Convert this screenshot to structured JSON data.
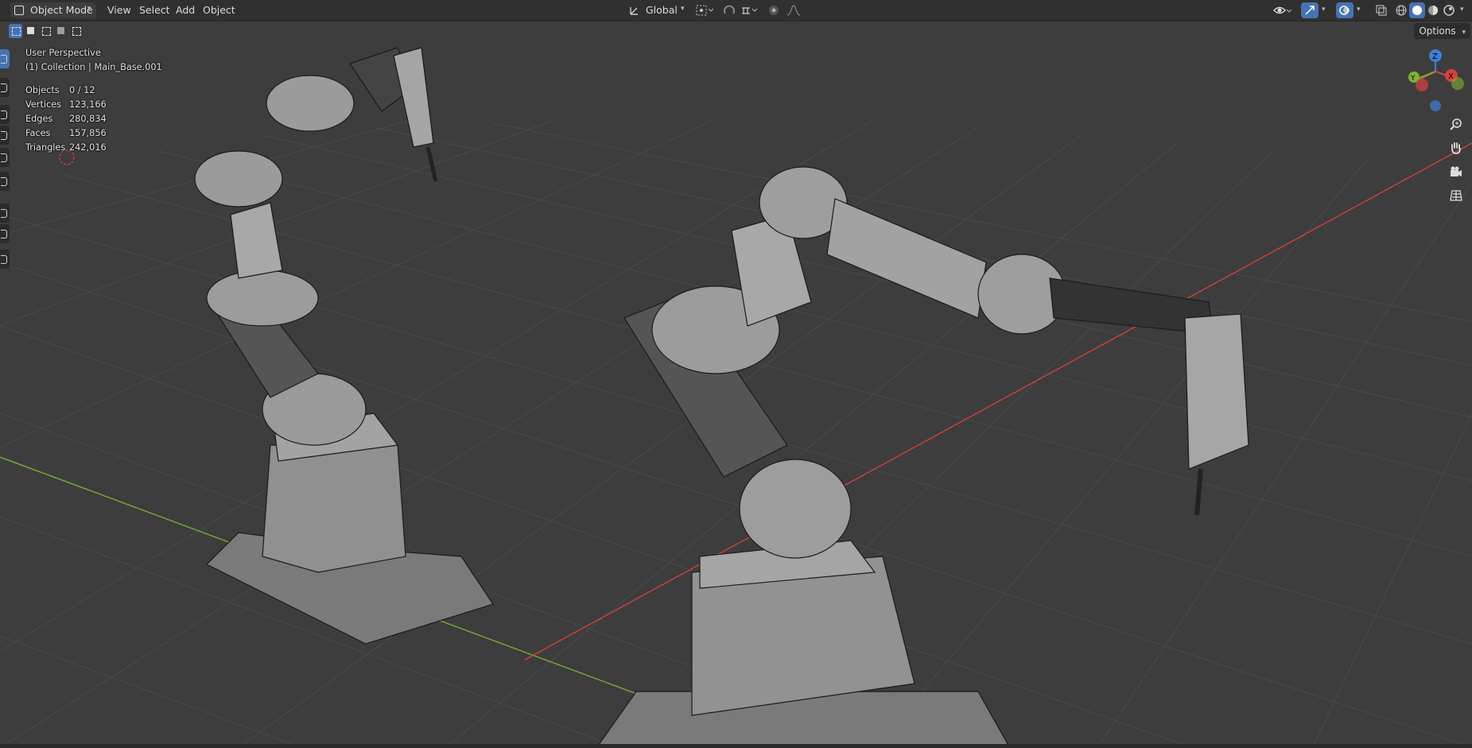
{
  "header": {
    "mode_label": "Object Mode",
    "menu": [
      "View",
      "Select",
      "Add",
      "Object"
    ],
    "transform_orientation": "Global",
    "icons": [
      "object-mode-icon",
      "transform-orientation-icon",
      "pivot-point-icon",
      "snap-icon",
      "snap-increment-icon",
      "proportional-editing-icon",
      "falloff-icon",
      "visibility-icon",
      "gizmo-icon",
      "overlay-icon",
      "xray-icon",
      "wireframe-shading-icon",
      "solid-shading-icon",
      "material-shading-icon",
      "rendered-shading-icon"
    ]
  },
  "toolbar": {
    "options_label": "Options",
    "select_modes": [
      "select-new-icon",
      "select-extend-icon",
      "select-subtract-icon",
      "select-invert-icon",
      "select-intersect-icon"
    ],
    "tools": [
      "select-box-icon",
      "cursor-icon",
      "move-icon",
      "rotate-icon",
      "scale-icon",
      "transform-icon",
      "annotate-icon",
      "measure-icon",
      "add-cube-icon"
    ]
  },
  "overlay": {
    "view_name": "User Perspective",
    "collection_info": "(1) Collection | Main_Base.001",
    "stats": [
      {
        "label": "Objects",
        "value": "0 / 12"
      },
      {
        "label": "Vertices",
        "value": "123,166"
      },
      {
        "label": "Edges",
        "value": "280,834"
      },
      {
        "label": "Faces",
        "value": "157,856"
      },
      {
        "label": "Triangles",
        "value": "242,016"
      }
    ]
  },
  "gizmo": {
    "x_label": "X",
    "y_label": "Y",
    "z_label": "Z"
  },
  "navigation": [
    "zoom-icon",
    "pan-hand-icon",
    "camera-view-icon",
    "ortho-grid-icon"
  ],
  "colors": {
    "accent": "#4772b3",
    "x_axis": "#d8403f",
    "y_axis": "#7fb236",
    "z_axis": "#3f7fd6",
    "grid_bg": "#3d3d3d"
  }
}
